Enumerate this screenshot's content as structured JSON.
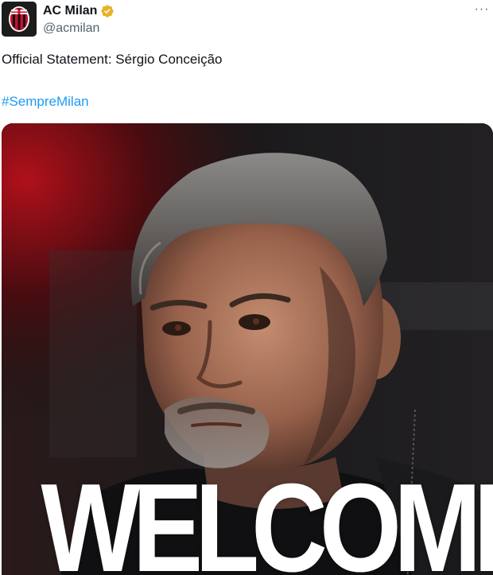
{
  "post": {
    "author": {
      "display_name": "AC Milan",
      "handle": "@acmilan",
      "verified_badge": "gold-verified-badge-icon"
    },
    "more_menu_label": "···",
    "text": "Official Statement: Sérgio Conceição",
    "hashtag": "#SempreMilan",
    "media": {
      "overlay_text": "WELCOME",
      "description_icon": "photo-of-coach"
    }
  },
  "colors": {
    "text": "#0f1419",
    "secondary": "#536471",
    "link": "#1d9bf0",
    "badge": "#e8b229",
    "milan_red": "#c8102e"
  }
}
